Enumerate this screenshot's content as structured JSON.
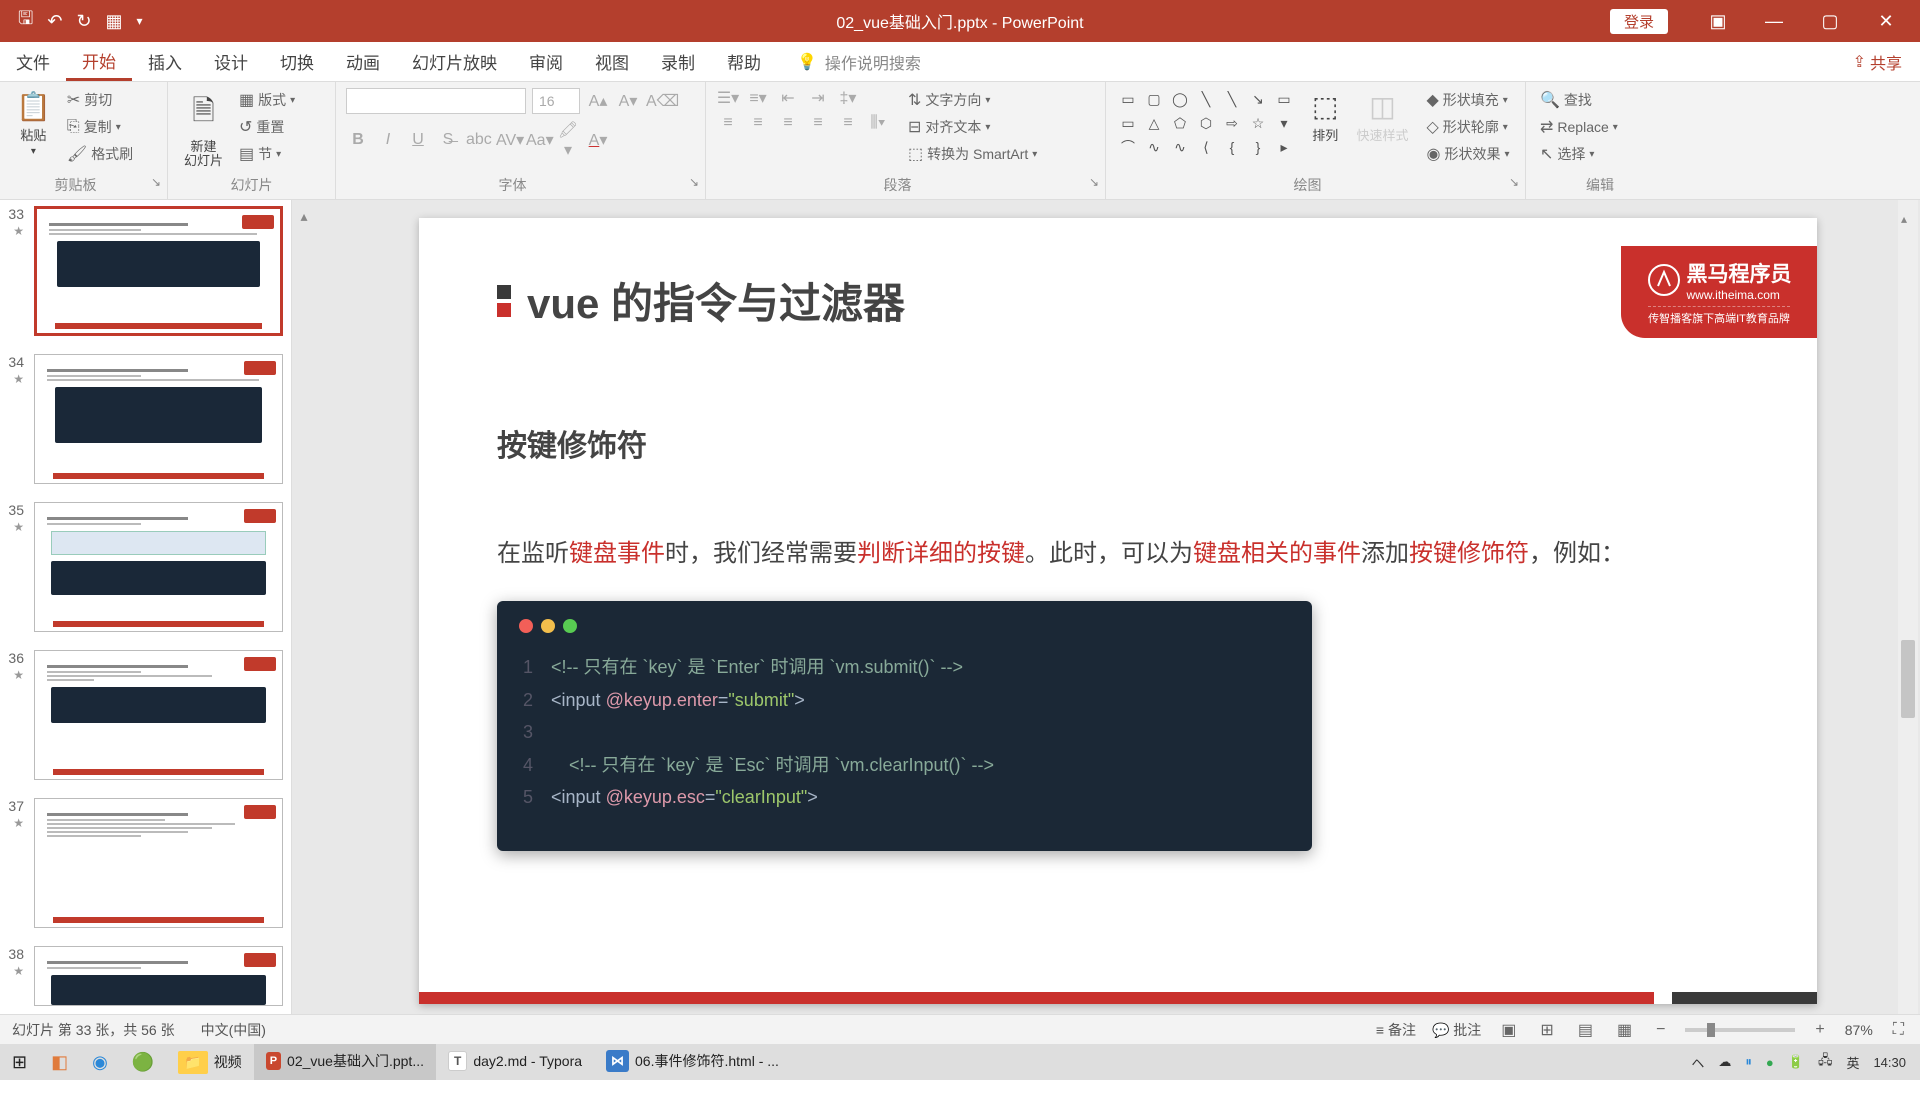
{
  "titlebar": {
    "doc_title": "02_vue基础入门.pptx - PowerPoint",
    "login": "登录"
  },
  "tabs": {
    "file": "文件",
    "home": "开始",
    "insert": "插入",
    "design": "设计",
    "transitions": "切换",
    "animations": "动画",
    "slideshow": "幻灯片放映",
    "review": "审阅",
    "view": "视图",
    "recording": "录制",
    "help": "帮助",
    "tellme": "操作说明搜索",
    "share": "共享"
  },
  "ribbon": {
    "clipboard": {
      "label": "剪贴板",
      "paste": "粘贴",
      "cut": "剪切",
      "copy": "复制",
      "format_painter": "格式刷"
    },
    "slides": {
      "label": "幻灯片",
      "new_slide": "新建\n幻灯片",
      "layout": "版式",
      "reset": "重置",
      "section": "节"
    },
    "font": {
      "label": "字体",
      "size": "16"
    },
    "paragraph": {
      "label": "段落",
      "text_dir": "文字方向",
      "align_text": "对齐文本",
      "smartart": "转换为 SmartArt"
    },
    "drawing": {
      "label": "绘图",
      "arrange": "排列",
      "quick_styles": "快速样式",
      "shape_fill": "形状填充",
      "shape_outline": "形状轮廓",
      "shape_effects": "形状效果"
    },
    "editing": {
      "label": "编辑",
      "find": "查找",
      "replace": "Replace",
      "select": "选择"
    }
  },
  "thumbnails": {
    "numbers": [
      "33",
      "34",
      "35",
      "36",
      "37",
      "38"
    ],
    "star": "★"
  },
  "slide": {
    "title": "vue 的指令与过滤器",
    "subtitle": "按键修饰符",
    "para_1": "在监听",
    "para_2": "键盘事件",
    "para_3": "时，我们经常需要",
    "para_4": "判断详细的按键",
    "para_5": "。此时，可以为",
    "para_6": "键盘相关的事件",
    "para_7": "添加",
    "para_8": "按键修饰符",
    "para_9": "，例如：",
    "code": {
      "l1_cmt": "<!-- 只有在 `key` 是 `Enter` 时调用 `vm.submit()` -->",
      "l2_a": "<input",
      "l2_b": "@keyup.enter",
      "l2_c": "=",
      "l2_d": "\"submit\"",
      "l2_e": ">",
      "l4_cmt": "<!-- 只有在 `key` 是 `Esc` 时调用 `vm.clearInput()` -->",
      "l5_a": "<input",
      "l5_b": "@keyup.esc",
      "l5_c": "=",
      "l5_d": "\"clearInput\"",
      "l5_e": ">"
    },
    "logo": {
      "t1": "黑马程序员",
      "t2": "www.itheima.com",
      "t3": "传智播客旗下高端IT教育品牌"
    }
  },
  "statusbar": {
    "slide_info": "幻灯片 第 33 张，共 56 张",
    "lang": "中文(中国)",
    "notes": "备注",
    "comments": "批注",
    "zoom": "87%"
  },
  "taskbar": {
    "videos": "视频",
    "ppt": "02_vue基础入门.ppt...",
    "typora": "day2.md - Typora",
    "vscode": "06.事件修饰符.html - ...",
    "ime": "英",
    "time": "14:30"
  }
}
